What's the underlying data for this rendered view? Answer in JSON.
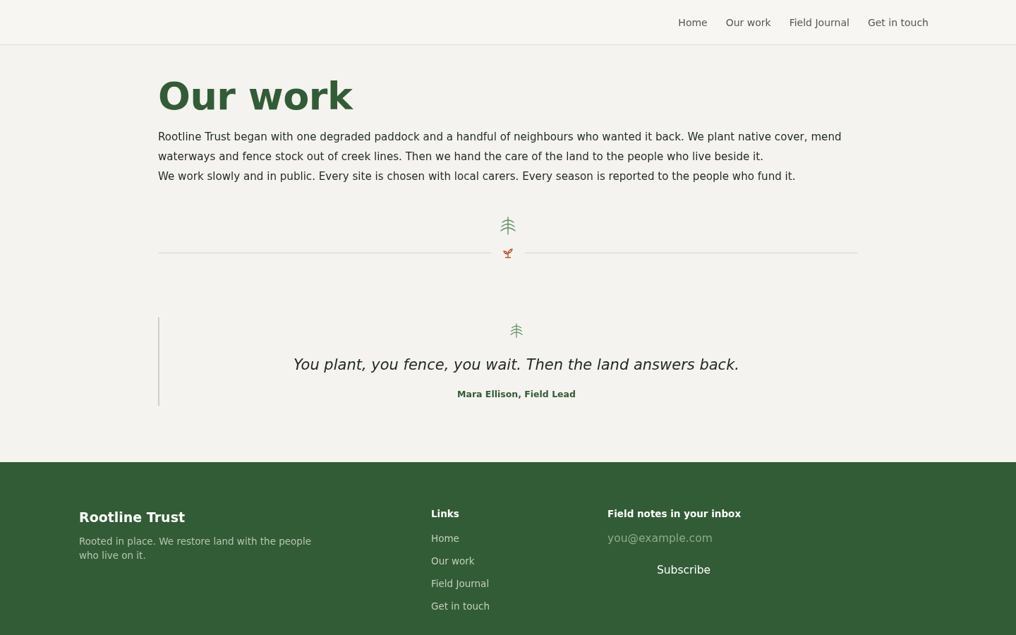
{
  "header": {
    "nav": [
      "Home",
      "Our work",
      "Field Journal",
      "Get in touch"
    ]
  },
  "intro": {
    "title": "Our work",
    "paragraphs": [
      "Rootline Trust began with one degraded paddock and a handful of neighbours who wanted it back. We plant native cover, mend waterways and fence stock out of creek lines. Then we hand the care of the land to the people who live beside it.",
      "We work slowly and in public. Every site is chosen with local carers. Every season is reported to the people who fund it."
    ]
  },
  "quote": {
    "text": "You plant, you fence, you wait. Then the land answers back.",
    "attribution": "Mara Ellison, Field Lead"
  },
  "footer": {
    "brand": "Rootline Trust",
    "tagline": "Rooted in place. We restore land with the people who live on it.",
    "links": {
      "heading": "Links",
      "items": [
        "Home",
        "Our work",
        "Field Journal",
        "Get in touch"
      ]
    },
    "newsletter": {
      "heading": "Field notes in your inbox",
      "placeholder": "you@example.com",
      "button": "Subscribe"
    }
  }
}
